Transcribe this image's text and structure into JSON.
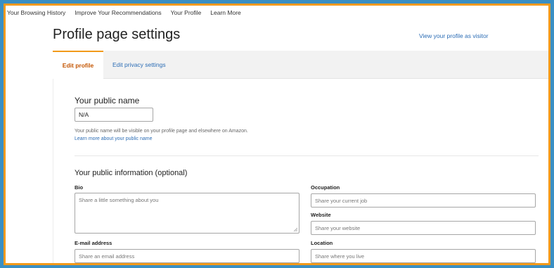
{
  "topnav": {
    "items": [
      "Your Browsing History",
      "Improve Your Recommendations",
      "Your Profile",
      "Learn More"
    ]
  },
  "header": {
    "title": "Profile page settings",
    "visitor_link": "View your profile as visitor"
  },
  "tabs": {
    "edit_profile": "Edit profile",
    "edit_privacy": "Edit privacy settings"
  },
  "public_name": {
    "heading": "Your public name",
    "value": "N/A",
    "hint": "Your public name will be visible on your profile page and elsewhere on Amazon.",
    "learn_more": "Learn more about your public name"
  },
  "public_info": {
    "heading": "Your public information (optional)",
    "bio": {
      "label": "Bio",
      "placeholder": "Share a little something about you"
    },
    "occupation": {
      "label": "Occupation",
      "placeholder": "Share your current job"
    },
    "website": {
      "label": "Website",
      "placeholder": "Share your website"
    },
    "email": {
      "label": "E-mail address",
      "placeholder": "Share an email address"
    },
    "location": {
      "label": "Location",
      "placeholder": "Share where you live"
    }
  },
  "colors": {
    "frame_border": "#f29a1a",
    "background": "#3a8fc4",
    "link": "#2c6db5",
    "active_tab": "#c45500"
  }
}
